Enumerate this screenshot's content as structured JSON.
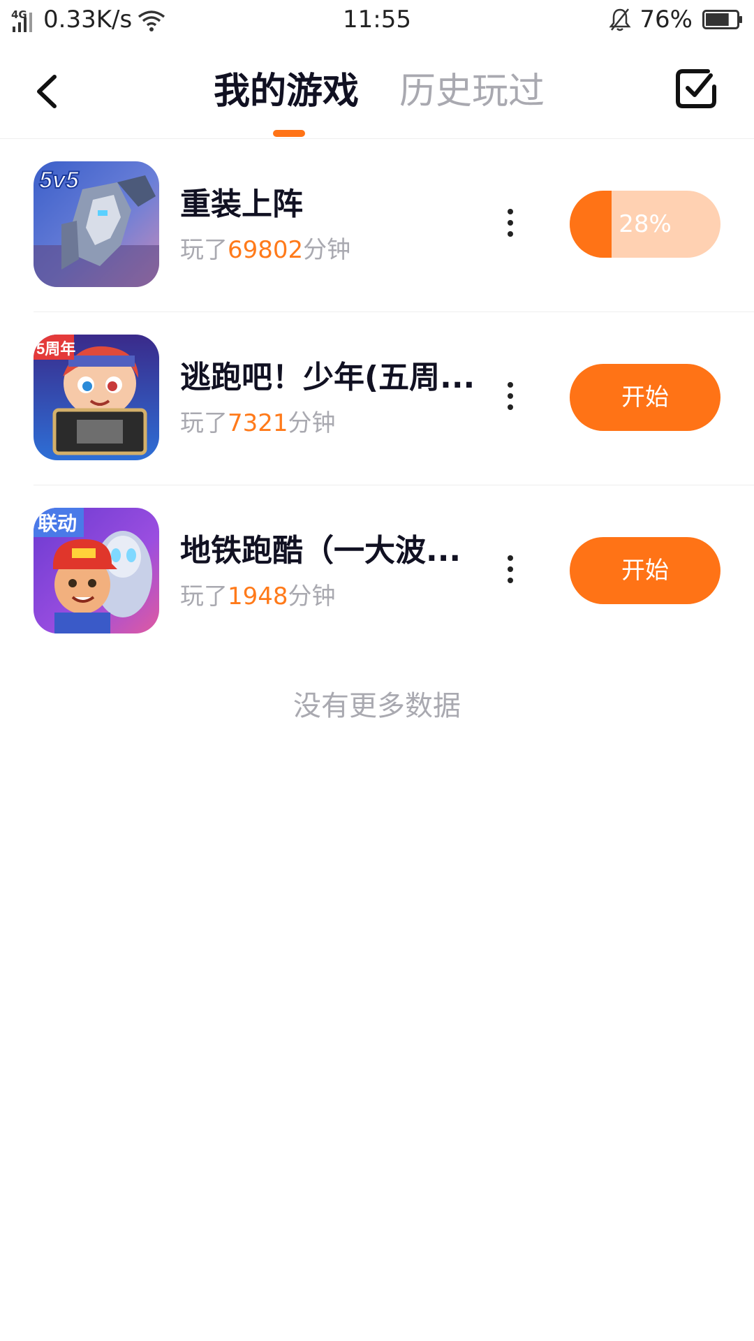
{
  "status_bar": {
    "network": "4G",
    "speed": "0.33K/s",
    "time": "11:55",
    "battery_percent": "76%",
    "battery_level": 0.76
  },
  "nav": {
    "tab_my_games": "我的游戏",
    "tab_history": "历史玩过",
    "accent_color": "#ff7316"
  },
  "games": [
    {
      "name": "重装上阵",
      "played_prefix": "玩了",
      "minutes": "69802",
      "played_suffix": "分钟",
      "action": "28%",
      "progress": 0.28,
      "icon_badge": "5v5"
    },
    {
      "name": "逃跑吧！少年(五周...",
      "played_prefix": "玩了",
      "minutes": "7321",
      "played_suffix": "分钟",
      "action": "开始",
      "icon_badge": "5周年"
    },
    {
      "name": "地铁跑酷（一大波...",
      "played_prefix": "玩了",
      "minutes": "1948",
      "played_suffix": "分钟",
      "action": "开始",
      "icon_badge": "联动"
    }
  ],
  "footer": {
    "no_more": "没有更多数据"
  }
}
